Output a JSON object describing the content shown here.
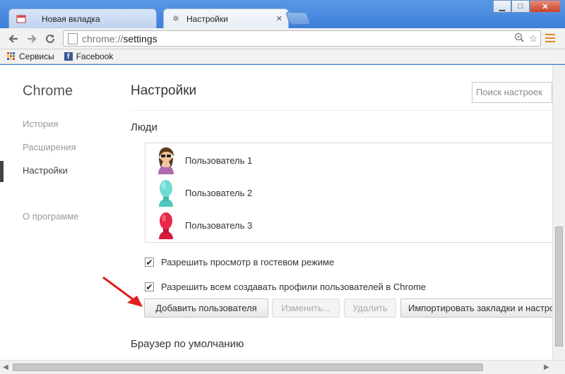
{
  "tabs": [
    {
      "title": "Новая вкладка",
      "active": false
    },
    {
      "title": "Настройки",
      "active": true
    }
  ],
  "window_buttons": {
    "minimize": "▁",
    "maximize": "□",
    "close": "✕"
  },
  "toolbar": {
    "back_icon": "arrow-left-icon",
    "forward_icon": "arrow-right-icon",
    "reload_icon": "reload-icon",
    "url_scheme": "chrome://",
    "url_path": "settings"
  },
  "bookmarks": [
    {
      "label": "Сервисы",
      "icon": "apps-icon"
    },
    {
      "label": "Facebook",
      "icon": "facebook-icon"
    }
  ],
  "sidebar": {
    "brand": "Chrome",
    "items": [
      {
        "label": "История"
      },
      {
        "label": "Расширения"
      },
      {
        "label": "Настройки"
      },
      {
        "label": "О программе"
      }
    ]
  },
  "main": {
    "title": "Настройки",
    "search_placeholder": "Поиск настроек",
    "people_section": "Люди",
    "profiles": [
      {
        "name": "Пользователь 1",
        "avatar": "user-avatar-woman-icon"
      },
      {
        "name": "Пользователь 2",
        "avatar": "user-avatar-teal-icon"
      },
      {
        "name": "Пользователь 3",
        "avatar": "user-avatar-red-icon"
      }
    ],
    "checkboxes": [
      {
        "label": "Разрешить просмотр в гостевом режиме",
        "checked": true
      },
      {
        "label": "Разрешить всем создавать профили пользователей в Chrome",
        "checked": true
      }
    ],
    "buttons": {
      "add": "Добавить пользователя",
      "edit": "Изменить...",
      "remove": "Удалить",
      "import": "Импортировать закладки и настройки"
    },
    "default_browser_section": "Браузер по умолчанию"
  },
  "colors": {
    "accent_annotation": "#e02020",
    "frame_blue": "#3d7fd8",
    "menu_orange": "#e08a1e"
  }
}
